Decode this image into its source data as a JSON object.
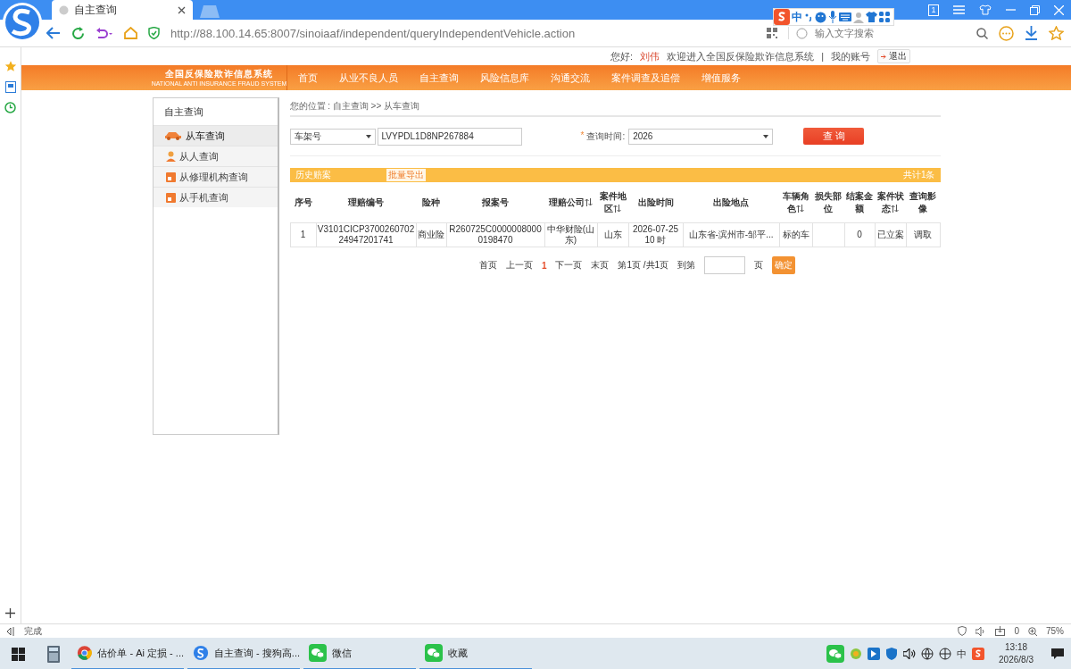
{
  "browser": {
    "tab": {
      "title": "自主查询",
      "selected": true
    },
    "address": "http://88.100.14.65:8007/sinoiaaf/independent/queryIndependentVehicle.action",
    "search_placeholder": "输入文字搜索",
    "window_count": "1",
    "ime_mode": "中"
  },
  "header": {
    "greeting": "您好:",
    "user": "刘伟",
    "welcome": "欢迎进入全国反保险欺诈信息系统",
    "separator": "|",
    "account": "我的账号",
    "logout": "退出"
  },
  "logo": {
    "title": "全国反保险欺诈信息系统",
    "subtitle": "NATIONAL ANTI INSURANCE FRAUD SYSTEM"
  },
  "nav": [
    "首页",
    "从业不良人员",
    "自主查询",
    "风险信息库",
    "沟通交流",
    "案件调查及追偿",
    "增值服务"
  ],
  "sidebar": {
    "title": "自主查询",
    "items": [
      {
        "label": "从车查询",
        "kind": "car",
        "selected": true
      },
      {
        "label": "从人查询",
        "kind": "person",
        "selected": false
      },
      {
        "label": "从修理机构查询",
        "kind": "shop",
        "selected": false
      },
      {
        "label": "从手机查询",
        "kind": "shop",
        "selected": false
      }
    ]
  },
  "breadcrumb": "您的位置 : 自主查询 >> 从车查询",
  "search": {
    "field_type": "车架号",
    "value": "LVYPDL1D8NP267884",
    "time_label": "查询时间:",
    "required_mark": "*",
    "year": "2026",
    "submit": "查 询"
  },
  "results": {
    "title": "历史赔案",
    "export": "批量导出",
    "total": "共计1条"
  },
  "table": {
    "columns": [
      {
        "label": "序号",
        "sortable": false
      },
      {
        "label": "理赔编号",
        "sortable": false
      },
      {
        "label": "险种",
        "sortable": false
      },
      {
        "label": "报案号",
        "sortable": false
      },
      {
        "label": "理赔公司",
        "sortable": true
      },
      {
        "label": "案件地区",
        "sortable": true
      },
      {
        "label": "出险时间",
        "sortable": false
      },
      {
        "label": "出险地点",
        "sortable": false
      },
      {
        "label": "车辆角色",
        "sortable": true
      },
      {
        "label": "损失部位",
        "sortable": false
      },
      {
        "label": "结案金额",
        "sortable": false
      },
      {
        "label": "案件状态",
        "sortable": true
      },
      {
        "label": "查询影像",
        "sortable": false
      }
    ],
    "rows": [
      [
        "1",
        "V3101CICP370026070224947201741",
        "商业险",
        "R260725C00000080000198470",
        "中华财险(山东)",
        "山东",
        "2026-07-25 10 时",
        "山东省-滨州市-邹平...",
        "标的车",
        "",
        "0",
        "已立案",
        "调取"
      ]
    ]
  },
  "pagination": {
    "first": "首页",
    "prev": "上一页",
    "current": "1",
    "next": "下一页",
    "last": "末页",
    "info": "第1页 /共1页",
    "goto": "到第",
    "unit": "页",
    "confirm": "确定"
  },
  "status_bar": {
    "text": "完成",
    "count": "0",
    "zoom": "75%"
  },
  "taskbar": {
    "items": [
      {
        "label": "估价单 - Ai 定损 - ...",
        "kind": "chrome"
      },
      {
        "label": "自主查询 - 搜狗高...",
        "kind": "sogou"
      },
      {
        "label": "微信",
        "kind": "wechat"
      },
      {
        "label": "收藏",
        "kind": "wechat"
      }
    ],
    "ime": "中",
    "time": "13:18",
    "date": "2026/8/3"
  }
}
